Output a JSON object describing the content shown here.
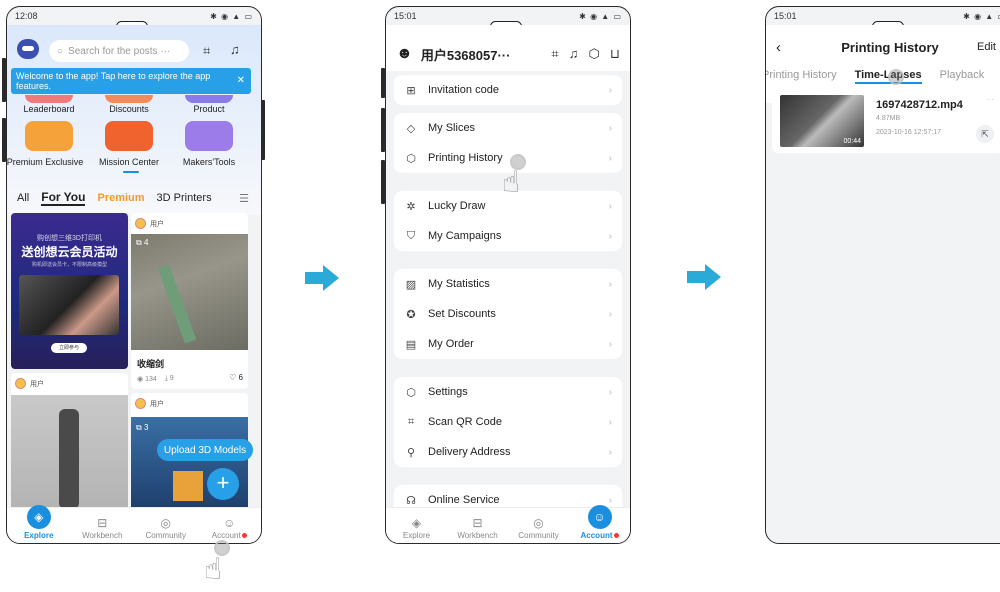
{
  "screen1": {
    "status_time": "12:08",
    "search_placeholder": "Search for the posts ···",
    "welcome": "Welcome to the app! Tap here to explore the app features.",
    "categories": [
      "Leaderboard",
      "Discounts",
      "Product",
      "Premium Exclusive",
      "Mission Center",
      "Makers'Tools"
    ],
    "tabs": [
      "All",
      "For You",
      "Premium",
      "3D Printers"
    ],
    "promo": {
      "line1": "购创想三维3D打印机",
      "line2": "送创想云会员活动",
      "line3": "购机即送会员卡，不限制高级模型",
      "button": "立即参与"
    },
    "post1": {
      "user": "用户",
      "badge": "4",
      "title": "收缩剑",
      "views": "134",
      "downloads": "9",
      "likes": "6"
    },
    "post2": {
      "user": "用户"
    },
    "post3": {
      "user": "用户",
      "badge": "3"
    },
    "upload_bubble": "Upload 3D Models",
    "nav": [
      "Explore",
      "Workbench",
      "Community",
      "Account"
    ]
  },
  "screen2": {
    "status_time": "15:01",
    "username": "用户5368057···",
    "menu": {
      "g1": [
        "Invitation code"
      ],
      "g2": [
        "My Slices",
        "Printing History"
      ],
      "g3": [
        "Lucky Draw",
        "My Campaigns"
      ],
      "g4": [
        "My Statistics",
        "Set Discounts",
        "My Order"
      ],
      "g5": [
        "Settings",
        "Scan QR Code",
        "Delivery Address"
      ],
      "g6": [
        "Online Service"
      ]
    },
    "nav": [
      "Explore",
      "Workbench",
      "Community",
      "Account"
    ]
  },
  "screen3": {
    "status_time": "15:01",
    "title": "Printing History",
    "edit": "Edit",
    "tabs": [
      "Printing History",
      "Time-Lapses",
      "Playback"
    ],
    "file": {
      "name": "1697428712.mp4",
      "size": "4.87MB",
      "date": "2023-10-16 12:57:17",
      "duration": "00:44"
    }
  },
  "colors": {
    "accent": "#1a8fe0",
    "premium": "#f59a23",
    "arrow": "#2aaad6"
  }
}
